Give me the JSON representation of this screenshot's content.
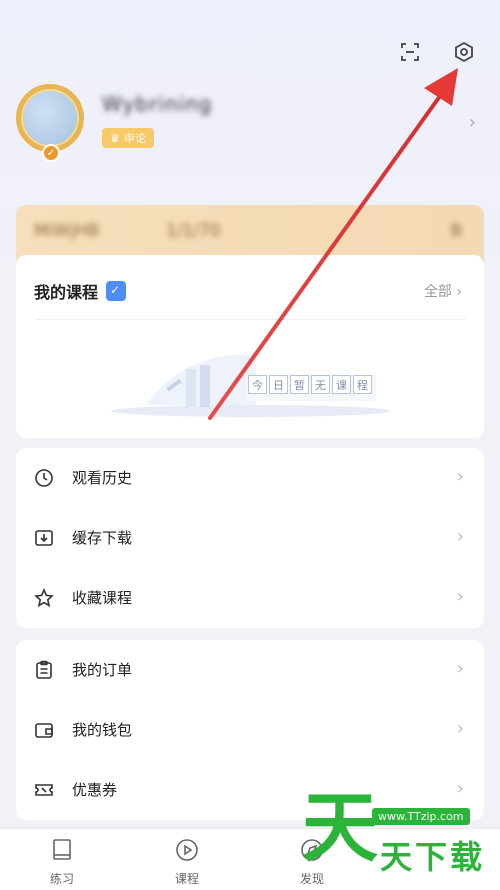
{
  "profile": {
    "username": "Wybrining",
    "vip_label": "申论"
  },
  "vip_banner": {
    "text_left": "MiWjHB",
    "text_middle": "1/1/70",
    "text_right": "B"
  },
  "courses": {
    "title": "我的课程",
    "all_label": "全部 ›",
    "empty_text": [
      "今",
      "日",
      "暂",
      "无",
      "课",
      "程"
    ]
  },
  "menu1": {
    "items": [
      {
        "label": "观看历史",
        "icon": "history-icon"
      },
      {
        "label": "缓存下载",
        "icon": "download-icon"
      },
      {
        "label": "收藏课程",
        "icon": "star-icon"
      }
    ]
  },
  "menu2": {
    "items": [
      {
        "label": "我的订单",
        "icon": "order-icon"
      },
      {
        "label": "我的钱包",
        "icon": "wallet-icon"
      },
      {
        "label": "优惠券",
        "icon": "coupon-icon"
      }
    ]
  },
  "nav": {
    "practice": "练习",
    "course": "课程",
    "discover": "发现"
  },
  "watermark": {
    "big": "天",
    "url": "www.TTzip.com",
    "text": "天下载"
  },
  "colors": {
    "accent": "#4c8ef5",
    "vip": "#f7c96a",
    "arrow": "#e53935",
    "watermark": "#2bb33a"
  }
}
